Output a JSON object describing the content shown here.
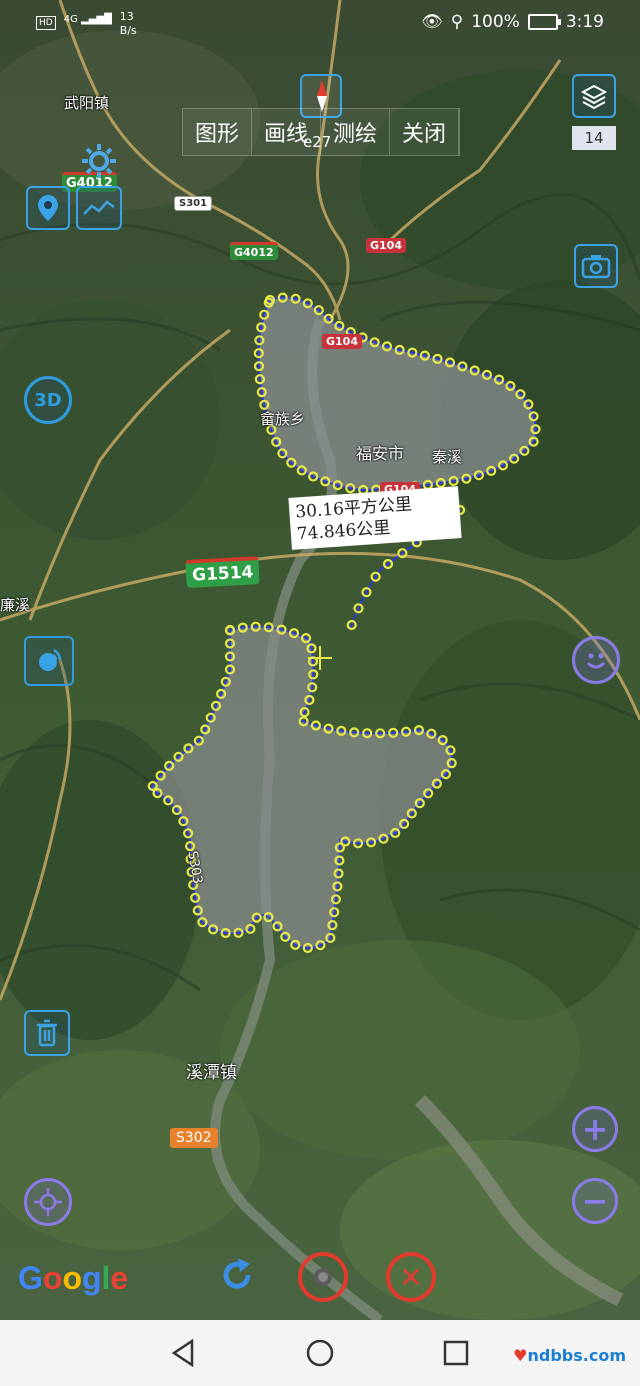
{
  "status_bar": {
    "hd": "HD",
    "network": "4G",
    "speed_value": "13",
    "speed_unit": "B/s",
    "battery": "100%",
    "time": "3:19"
  },
  "toolbar": {
    "tabs": [
      "图形",
      "画线",
      "测绘",
      "关闭"
    ],
    "overlay_text": "e27"
  },
  "zoom_level": "14",
  "measurement": {
    "area": "30.16平方公里",
    "perimeter": "74.846公里"
  },
  "map_labels": {
    "town_wuyang": "武阳镇",
    "town_shexiang": "畲族乡",
    "city": "福安市",
    "district": "秦溪",
    "lianxi": "廉溪",
    "xitan": "溪潭镇",
    "road_s303": "S303"
  },
  "road_shields": {
    "g4012_a": "G4012",
    "g4012_b": "G4012",
    "s301": "S301",
    "g104_a": "G104",
    "g104_b": "G104",
    "g104_c": "G104",
    "g1514": "G1514",
    "s302": "S302"
  },
  "branding": {
    "google": "Google",
    "watermark": "ndbbs.com"
  },
  "icons": [
    "layers-icon",
    "compass-icon",
    "gear-icon",
    "location-pin-icon",
    "track-icon",
    "camera-icon",
    "3d-icon",
    "signal-icon",
    "smile-icon",
    "trash-icon",
    "zoom-in-icon",
    "zoom-out-icon",
    "target-icon",
    "refresh-icon",
    "record-icon",
    "cancel-icon"
  ],
  "colors": {
    "accent_blue": "#3aa3e6",
    "accent_purple": "#8a7be8",
    "accent_red": "#e23b2e",
    "polygon_vertex": "#e6e84a",
    "polygon_edge": "#2b3bd8"
  }
}
